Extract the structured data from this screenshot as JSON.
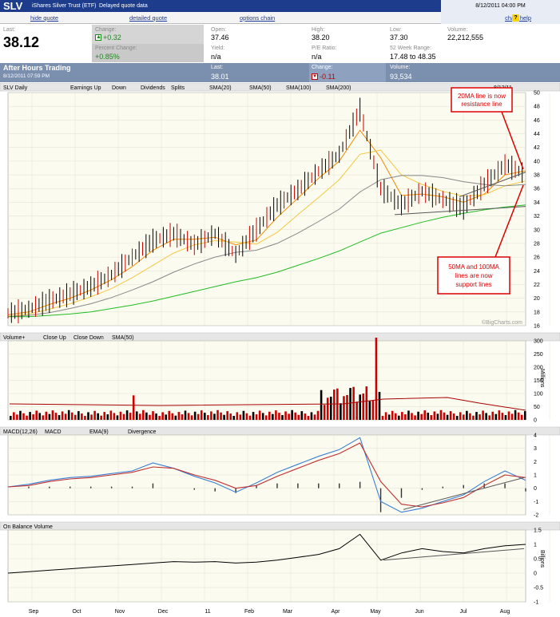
{
  "header": {
    "symbol": "SLV",
    "name": "iShares Silver Trust (ETF)",
    "delay": "Delayed quote data",
    "datetime": "8/12/2011 04:00 PM"
  },
  "links": {
    "hide": "hide quote",
    "detailed": "detailed quote",
    "options": "options chain",
    "help": "chart help",
    "help_icon": "?"
  },
  "quote": {
    "last_label": "Last:",
    "last": "38.12",
    "change_label": "Change:",
    "change": "+0.32",
    "pct_label": "Percent Change:",
    "pct": "+0.85%",
    "open_label": "Open:",
    "open": "37.46",
    "yield_label": "Yield:",
    "yield": "n/a",
    "high_label": "High:",
    "high": "38.20",
    "pe_label": "P/E Ratio:",
    "pe": "n/a",
    "low_label": "Low:",
    "low": "37.30",
    "range_label": "52 Week Range:",
    "range": "17.48 to 48.35",
    "volume_label": "Volume:",
    "volume": "22,212,555"
  },
  "after_hours": {
    "title": "After Hours Trading",
    "date": "8/12/2011 07:59 PM",
    "last_label": "Last:",
    "last": "38.01",
    "change_label": "Change:",
    "change": "-0.11",
    "volume_label": "Volume:",
    "volume": "93,534"
  },
  "colors": {
    "up": "#000000",
    "down": "#cc0000",
    "sma20": "#f08a00",
    "sma50": "#f5c842",
    "sma100": "#888888",
    "sma200": "#22bb22",
    "macd": "#3a7fd5",
    "ema": "#c03030",
    "header": "#1d3d8c"
  },
  "chart_data": [
    {
      "type": "line",
      "title": "SLV Daily",
      "legend": [
        "Earnings Up",
        "Down",
        "Dividends",
        "Splits",
        "SMA(20)",
        "SMA(50)",
        "SMA(100)",
        "SMA(200)"
      ],
      "x": [
        "Aug",
        "Sep",
        "Oct",
        "Nov",
        "Dec",
        "11",
        "Feb",
        "Mar",
        "Apr",
        "May",
        "Jun",
        "Jul",
        "Aug"
      ],
      "yticks": [
        16,
        18,
        20,
        22,
        24,
        26,
        28,
        30,
        32,
        34,
        36,
        38,
        40,
        42,
        44,
        46,
        48,
        50
      ],
      "ylim": [
        16,
        50
      ],
      "series": [
        {
          "name": "Price",
          "values": [
            17.8,
            18.4,
            19.6,
            20.6,
            21.7,
            23.4,
            26.0,
            28.4,
            29.4,
            27.8,
            29.4,
            26.4,
            30.0,
            33.6,
            35.8,
            38.5,
            41.0,
            47.5,
            36.0,
            33.6,
            35.6,
            34.4,
            33.2,
            36.6,
            39.5,
            38.1
          ]
        },
        {
          "name": "SMA(20)",
          "values": [
            17.6,
            18.0,
            19.1,
            20.0,
            21.2,
            22.7,
            24.6,
            27.0,
            28.6,
            28.6,
            28.9,
            27.8,
            28.5,
            31.8,
            34.6,
            37.5,
            40.0,
            44.5,
            40.5,
            35.0,
            35.2,
            34.8,
            34.0,
            35.2,
            38.0,
            38.6
          ]
        },
        {
          "name": "SMA(50)",
          "values": [
            17.4,
            17.7,
            18.4,
            19.2,
            20.2,
            21.4,
            23.0,
            24.8,
            26.6,
            27.8,
            28.4,
            28.2,
            27.9,
            29.6,
            32.2,
            34.7,
            37.3,
            41.0,
            41.6,
            38.0,
            36.6,
            35.6,
            34.9,
            35.1,
            36.4,
            37.1
          ]
        },
        {
          "name": "SMA(100)",
          "values": [
            17.3,
            17.5,
            17.9,
            18.5,
            19.2,
            20.1,
            21.2,
            22.4,
            23.8,
            25.0,
            26.0,
            26.7,
            27.0,
            28.0,
            29.5,
            31.2,
            33.0,
            35.5,
            37.3,
            37.9,
            37.9,
            37.6,
            37.0,
            36.6,
            36.4,
            36.6
          ]
        },
        {
          "name": "SMA(200)",
          "values": [
            17.3,
            17.3,
            17.5,
            17.7,
            18.0,
            18.5,
            19.0,
            19.6,
            20.3,
            21.0,
            21.7,
            22.4,
            23.0,
            23.8,
            24.8,
            25.8,
            26.9,
            28.2,
            29.5,
            30.3,
            31.1,
            31.8,
            32.4,
            32.9,
            33.3,
            33.6
          ]
        }
      ],
      "notes": [
        "20MA line is now resistance line",
        "50MA and 100MA lines are now support lines"
      ],
      "watermark": "©BigCharts.com",
      "date_label": "8/12/11"
    },
    {
      "type": "bar",
      "title": "Volume+",
      "legend": [
        "Close Up",
        "Close Down",
        "SMA(50)"
      ],
      "ylabel": "Millions",
      "yticks": [
        0,
        50,
        100,
        150,
        200,
        250,
        300
      ],
      "ylim": [
        0,
        300
      ]
    },
    {
      "type": "line",
      "title": "MACD(12,26)",
      "legend": [
        "MACD",
        "EMA(9)",
        "Divergence"
      ],
      "yticks": [
        -2,
        -1,
        0,
        1,
        2,
        3,
        4
      ],
      "ylim": [
        -2,
        4
      ],
      "series": [
        {
          "name": "MACD",
          "values": [
            0.1,
            0.3,
            0.6,
            0.8,
            0.9,
            1.1,
            1.3,
            1.9,
            1.5,
            0.9,
            0.4,
            -0.3,
            0.4,
            1.2,
            1.8,
            2.4,
            2.9,
            3.8,
            -1.0,
            -1.8,
            -1.5,
            -1.0,
            -0.5,
            0.5,
            1.3,
            0.6
          ]
        },
        {
          "name": "EMA(9)",
          "values": [
            0.1,
            0.2,
            0.5,
            0.7,
            0.8,
            1.0,
            1.2,
            1.6,
            1.5,
            1.0,
            0.6,
            0.0,
            0.2,
            0.9,
            1.5,
            2.1,
            2.6,
            3.4,
            0.5,
            -1.2,
            -1.4,
            -1.1,
            -0.7,
            0.2,
            1.0,
            0.8
          ]
        }
      ]
    },
    {
      "type": "line",
      "title": "On Balance Volume",
      "ylabel": "Billions",
      "yticks": [
        -1,
        -0.5,
        0,
        0.5,
        1,
        1.5
      ],
      "ylim": [
        -1,
        1.5
      ],
      "series": [
        {
          "name": "OBV",
          "values": [
            0.0,
            0.05,
            0.1,
            0.15,
            0.2,
            0.25,
            0.3,
            0.35,
            0.4,
            0.38,
            0.4,
            0.35,
            0.38,
            0.45,
            0.55,
            0.65,
            0.85,
            1.35,
            0.45,
            0.7,
            0.85,
            0.75,
            0.7,
            0.85,
            0.95,
            1.0
          ]
        }
      ]
    }
  ]
}
